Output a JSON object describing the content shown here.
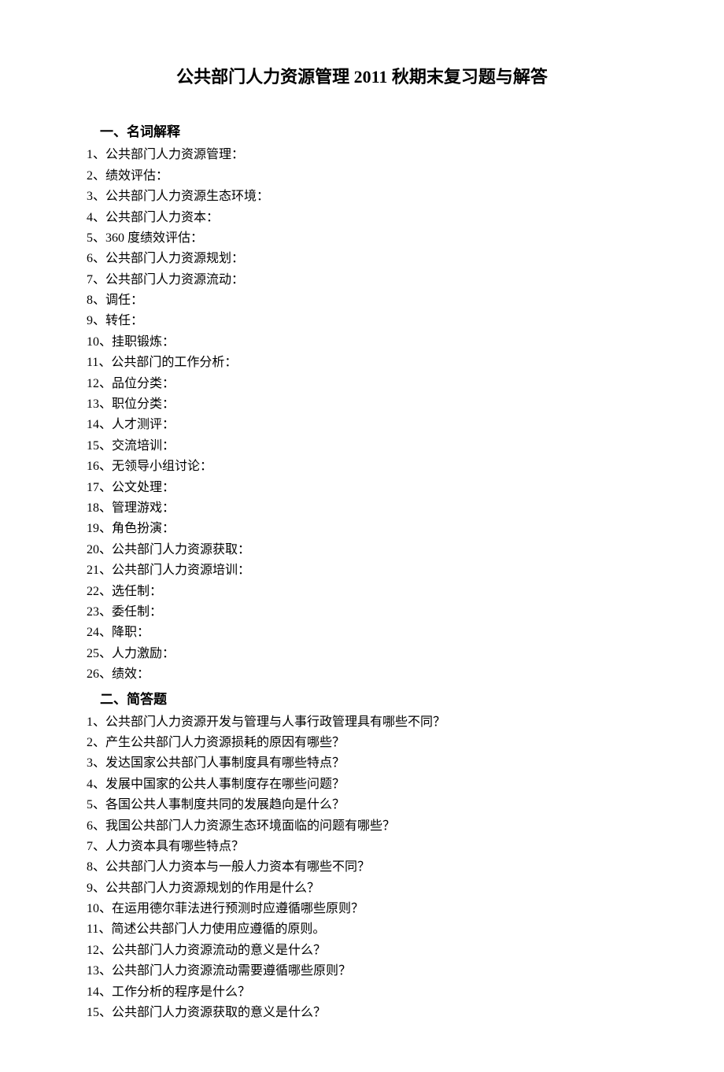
{
  "title": "公共部门人力资源管理 2011 秋期末复习题与解答",
  "section1": {
    "heading": "一、名词解释",
    "items": [
      "1、公共部门人力资源管理：",
      "2、绩效评估：",
      "3、公共部门人力资源生态环境：",
      "4、公共部门人力资本：",
      "5、360 度绩效评估：",
      "6、公共部门人力资源规划：",
      "7、公共部门人力资源流动：",
      "8、调任：",
      "9、转任：",
      "10、挂职锻炼：",
      "11、公共部门的工作分析：",
      "12、品位分类：",
      "13、职位分类：",
      "14、人才测评：",
      "15、交流培训：",
      "16、无领导小组讨论：",
      "17、公文处理：",
      "18、管理游戏：",
      "19、角色扮演：",
      "20、公共部门人力资源获取：",
      "21、公共部门人力资源培训：",
      "22、选任制：",
      "23、委任制：",
      "24、降职：",
      "25、人力激励：",
      "26、绩效："
    ]
  },
  "section2": {
    "heading": "二、简答题",
    "items": [
      "1、公共部门人力资源开发与管理与人事行政管理具有哪些不同？",
      "2、产生公共部门人力资源损耗的原因有哪些？",
      "3、发达国家公共部门人事制度具有哪些特点？",
      "4、发展中国家的公共人事制度存在哪些问题？",
      "5、各国公共人事制度共同的发展趋向是什么？",
      "6、我国公共部门人力资源生态环境面临的问题有哪些？",
      "7、人力资本具有哪些特点？",
      "8、公共部门人力资本与一般人力资本有哪些不同？",
      "9、公共部门人力资源规划的作用是什么？",
      "10、在运用德尔菲法进行预测时应遵循哪些原则？",
      "11、简述公共部门人力使用应遵循的原则。",
      "12、公共部门人力资源流动的意义是什么？",
      "13、公共部门人力资源流动需要遵循哪些原则？",
      "14、工作分析的程序是什么？",
      "15、公共部门人力资源获取的意义是什么？"
    ]
  }
}
